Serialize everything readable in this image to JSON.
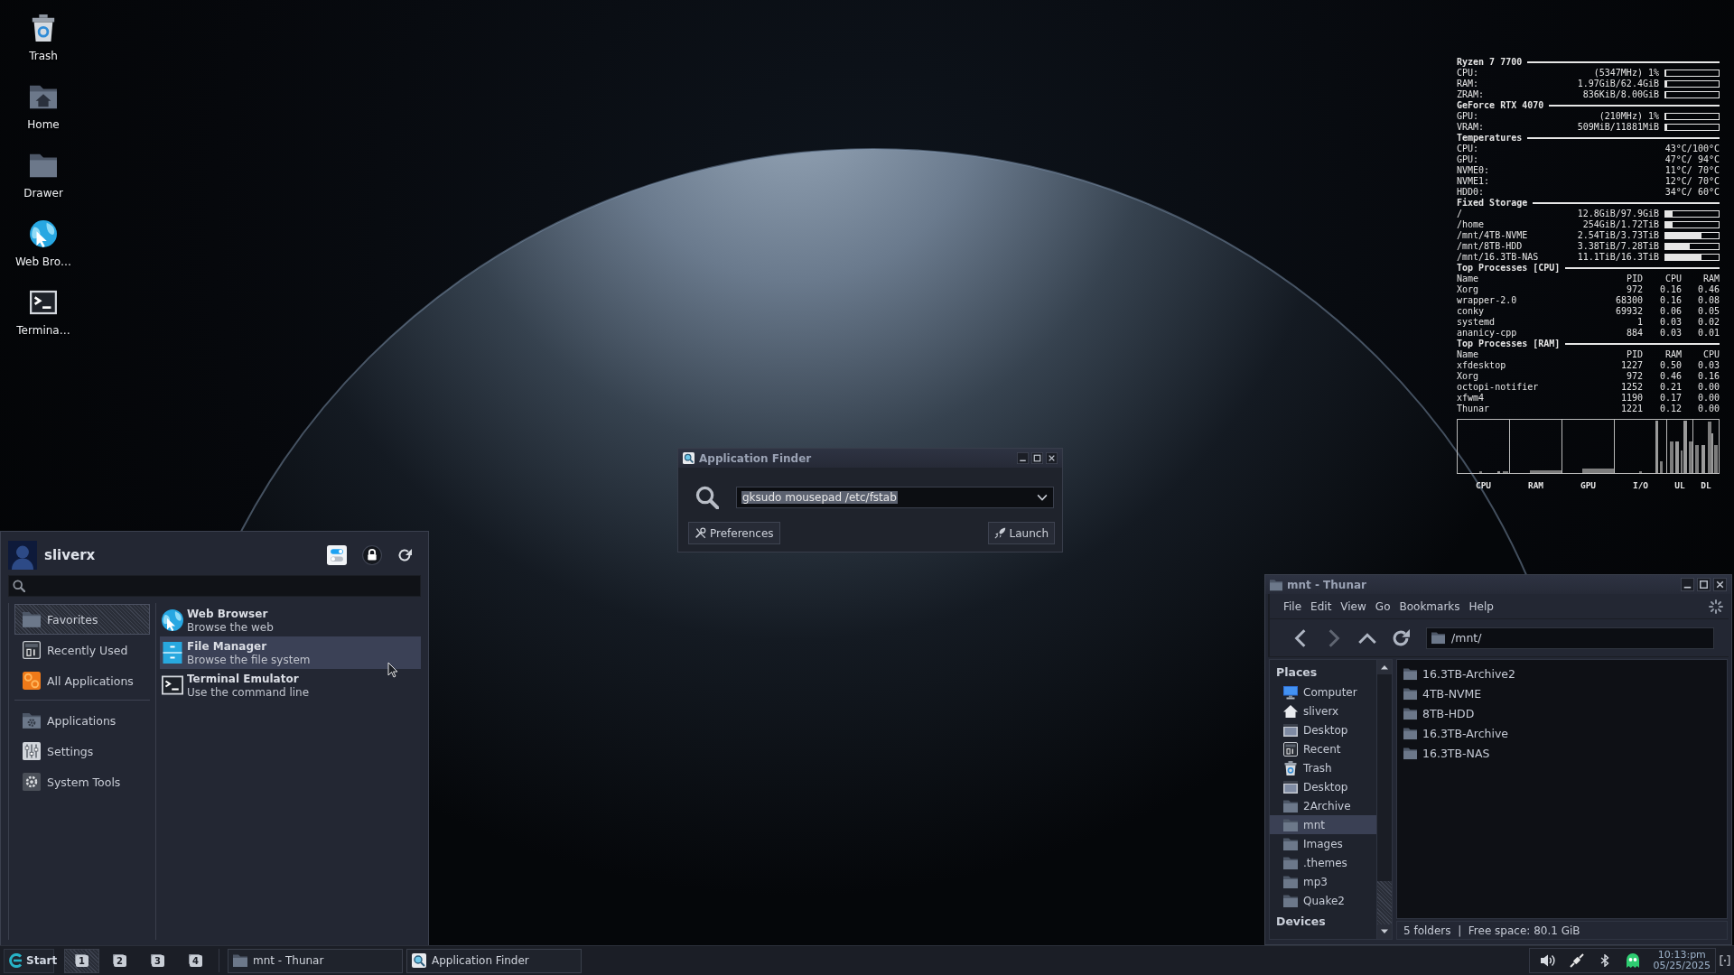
{
  "desktop_icons": [
    {
      "label": "Trash",
      "kind": "trash"
    },
    {
      "label": "Home",
      "kind": "home"
    },
    {
      "label": "Drawer",
      "kind": "folder"
    },
    {
      "label": "Web Bro…",
      "kind": "browser"
    },
    {
      "label": "Termina…",
      "kind": "terminal"
    }
  ],
  "system_monitor": {
    "sections": [
      {
        "kind": "stats",
        "title": "Ryzen 7 7700",
        "rows": [
          {
            "kind": "bar",
            "label": "CPU:",
            "value": "(5347MHz) 1%",
            "level": 0.01
          },
          {
            "kind": "bar",
            "label": "RAM:",
            "value": "1.97GiB/62.4GiB",
            "level": 0.03
          },
          {
            "kind": "bar",
            "label": "ZRAM:",
            "value": "836KiB/8.00GiB",
            "level": 0
          }
        ]
      },
      {
        "kind": "stats",
        "title": "GeForce RTX 4070",
        "rows": [
          {
            "kind": "bar",
            "label": "GPU:",
            "value": "(210MHz) 1%",
            "level": 0.01
          },
          {
            "kind": "bar",
            "label": "VRAM:",
            "value": "509MiB/11881MiB",
            "level": 0.04
          }
        ]
      },
      {
        "kind": "stats",
        "title": "Temperatures",
        "rows": [
          {
            "kind": "text",
            "label": "CPU:",
            "value": "43°C/100°C"
          },
          {
            "kind": "text",
            "label": "GPU:",
            "value": "47°C/ 94°C"
          },
          {
            "kind": "text",
            "label": "NVME0:",
            "value": "11°C/ 70°C"
          },
          {
            "kind": "text",
            "label": "NVME1:",
            "value": "12°C/ 70°C"
          },
          {
            "kind": "text",
            "label": "HDD0:",
            "value": "34°C/ 60°C"
          }
        ]
      },
      {
        "kind": "stats",
        "title": "Fixed Storage",
        "rows": [
          {
            "kind": "bar",
            "label": "/",
            "value": "12.8GiB/97.9GiB",
            "level": 0.13
          },
          {
            "kind": "bar",
            "label": "/home",
            "value": "254GiB/1.72TiB",
            "level": 0.14
          },
          {
            "kind": "bar",
            "label": "/mnt/4TB-NVME",
            "value": "2.54TiB/3.73TiB",
            "level": 0.68
          },
          {
            "kind": "bar",
            "label": "/mnt/8TB-HDD",
            "value": "3.38TiB/7.28TiB",
            "level": 0.46
          },
          {
            "kind": "bar",
            "label": "/mnt/16.3TB-NAS",
            "value": "11.1TiB/16.3TiB",
            "level": 0.68
          }
        ]
      },
      {
        "kind": "table",
        "title": "Top Processes [CPU]",
        "columns": [
          "Name",
          "PID",
          "CPU",
          "RAM"
        ],
        "rows": [
          [
            "Xorg",
            "972",
            "0.16",
            "0.46"
          ],
          [
            "wrapper-2.0",
            "68300",
            "0.16",
            "0.08"
          ],
          [
            "conky",
            "69932",
            "0.06",
            "0.05"
          ],
          [
            "systemd",
            "1",
            "0.03",
            "0.02"
          ],
          [
            "ananicy-cpp",
            "884",
            "0.03",
            "0.01"
          ]
        ]
      },
      {
        "kind": "table",
        "title": "Top Processes [RAM]",
        "columns": [
          "Name",
          "PID",
          "RAM",
          "CPU"
        ],
        "rows": [
          [
            "xfdesktop",
            "1227",
            "0.50",
            "0.03"
          ],
          [
            "Xorg",
            "972",
            "0.46",
            "0.16"
          ],
          [
            "octopi-notifier",
            "1252",
            "0.21",
            "0.00"
          ],
          [
            "xfwm4",
            "1190",
            "0.17",
            "0.00"
          ],
          [
            "Thunar",
            "1221",
            "0.12",
            "0.00"
          ]
        ]
      }
    ],
    "graphs": [
      {
        "label": "CPU"
      },
      {
        "label": "RAM"
      },
      {
        "label": "GPU"
      },
      {
        "label": "I/O"
      },
      {
        "label": "UL"
      },
      {
        "label": "DL"
      }
    ]
  },
  "app_finder": {
    "title": "Application Finder",
    "command": {
      "value": "gksudo mousepad /etc/fstab",
      "text_selected": true
    },
    "buttons": [
      {
        "label": "Preferences",
        "kind": "preferences"
      },
      {
        "label": "Launch",
        "kind": "launch"
      }
    ]
  },
  "start_menu": {
    "user": "sliverx",
    "category_groups": [
      [
        {
          "label": "Favorites",
          "kind": "favorites",
          "selected": true
        },
        {
          "label": "Recently Used",
          "kind": "recent",
          "selected": false
        },
        {
          "label": "All Applications",
          "kind": "all",
          "selected": false
        }
      ],
      [
        {
          "label": "Applications",
          "kind": "applications",
          "selected": false
        },
        {
          "label": "Settings",
          "kind": "settings",
          "selected": false
        },
        {
          "label": "System Tools",
          "kind": "system",
          "selected": false
        }
      ]
    ],
    "apps": [
      {
        "name": "Web Browser",
        "description": "Browse the web",
        "kind": "browser",
        "selected": false
      },
      {
        "name": "File Manager",
        "description": "Browse the file system",
        "kind": "file-manager",
        "selected": true
      },
      {
        "name": "Terminal Emulator",
        "description": "Use the command line",
        "kind": "terminal",
        "selected": false
      }
    ]
  },
  "file_manager": {
    "title": "mnt - Thunar",
    "menu": [
      "File",
      "Edit",
      "View",
      "Go",
      "Bookmarks",
      "Help"
    ],
    "toolbar": [
      {
        "kind": "back",
        "disabled": false
      },
      {
        "kind": "forward",
        "disabled": true
      },
      {
        "kind": "up",
        "disabled": false
      },
      {
        "kind": "reload",
        "disabled": false
      }
    ],
    "location": "/mnt/",
    "sidebar": [
      {
        "heading": "Places",
        "items": [
          {
            "label": "Computer",
            "kind": "computer",
            "selected": false
          },
          {
            "label": "sliverx",
            "kind": "home",
            "selected": false
          },
          {
            "label": "Desktop",
            "kind": "desktop",
            "selected": false
          },
          {
            "label": "Recent",
            "kind": "recent",
            "selected": false
          },
          {
            "label": "Trash",
            "kind": "trash",
            "selected": false
          },
          {
            "label": "Desktop",
            "kind": "desktop",
            "selected": false
          },
          {
            "label": "2Archive",
            "kind": "folder",
            "selected": false
          },
          {
            "label": "mnt",
            "kind": "folder",
            "selected": true
          },
          {
            "label": "Images",
            "kind": "folder",
            "selected": false
          },
          {
            "label": ".themes",
            "kind": "folder",
            "selected": false
          },
          {
            "label": "mp3",
            "kind": "folder",
            "selected": false
          },
          {
            "label": "Quake2",
            "kind": "folder",
            "selected": false
          }
        ]
      },
      {
        "heading": "Devices"
      }
    ],
    "files": [
      "16.3TB-Archive2",
      "4TB-NVME",
      "8TB-HDD",
      "16.3TB-Archive",
      "16.3TB-NAS"
    ],
    "status": "5 folders  |  Free space: 80.1 GiB"
  },
  "taskbar": {
    "start": "Start",
    "workspaces": [
      {
        "label": "1",
        "selected": true
      },
      {
        "label": "2",
        "selected": false
      },
      {
        "label": "3",
        "selected": false
      },
      {
        "label": "4",
        "selected": false
      }
    ],
    "tasks": [
      {
        "title": "mnt - Thunar",
        "kind": "file-manager"
      },
      {
        "title": "Application Finder",
        "kind": "app-finder"
      }
    ],
    "clock": {
      "time": "10:13:pm",
      "date": "05/25/2025"
    }
  }
}
